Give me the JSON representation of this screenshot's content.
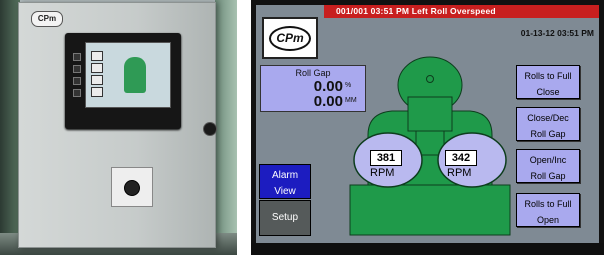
{
  "photo": {
    "logo": "CPm"
  },
  "hmi": {
    "alarm_banner": "001/001  03:51 PM  Left Roll Overspeed",
    "datetime": "01-13-12 03:51 PM",
    "brand_logo": "CPm",
    "roll_gap": {
      "label": "Roll Gap",
      "percent_value": "0.00",
      "percent_unit": "%",
      "mm_value": "0.00",
      "mm_unit": "MM"
    },
    "left_roll": {
      "rpm": "381",
      "unit": "RPM"
    },
    "right_roll": {
      "rpm": "342",
      "unit": "RPM"
    },
    "buttons": {
      "alarm_view_line1": "Alarm",
      "alarm_view_line2": "View",
      "setup": "Setup",
      "rolls_full_close_line1": "Rolls to Full",
      "rolls_full_close_line2": "Close",
      "close_dec_line1": "Close/Dec",
      "close_dec_line2": "Roll Gap",
      "open_inc_line1": "Open/Inc",
      "open_inc_line2": "Roll Gap",
      "rolls_full_open_line1": "Rolls to Full",
      "rolls_full_open_line2": "Open"
    },
    "colors": {
      "alarm_bar": "#c81f1f",
      "button_fill": "#a9a9ee",
      "machine_green": "#1f9a4a",
      "roll_fill": "#b9b9ef",
      "screen_background": "#7f8a94"
    }
  }
}
